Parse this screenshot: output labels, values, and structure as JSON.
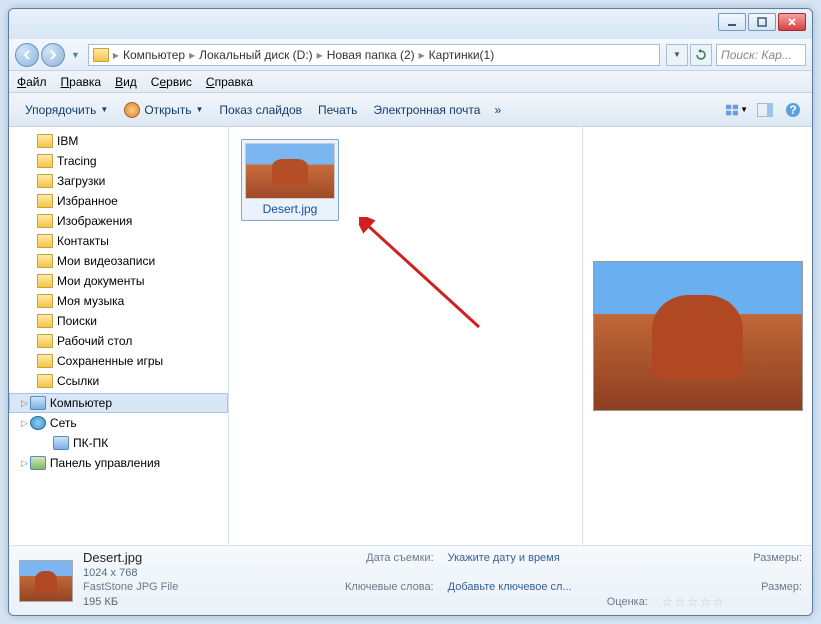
{
  "search_placeholder": "Поиск: Кар...",
  "breadcrumbs": [
    "Компьютер",
    "Локальный диск (D:)",
    "Новая папка (2)",
    "Картинки(1)"
  ],
  "menu": {
    "file": "Файл",
    "edit": "Правка",
    "view": "Вид",
    "tools": "Сервис",
    "help": "Справка"
  },
  "cmd": {
    "organize": "Упорядочить",
    "open": "Открыть",
    "slideshow": "Показ слайдов",
    "print": "Печать",
    "email": "Электронная почта"
  },
  "tree": {
    "items": [
      {
        "label": "IBM",
        "icon": "folder"
      },
      {
        "label": "Tracing",
        "icon": "folder"
      },
      {
        "label": "Загрузки",
        "icon": "folder"
      },
      {
        "label": "Избранное",
        "icon": "folder"
      },
      {
        "label": "Изображения",
        "icon": "folder"
      },
      {
        "label": "Контакты",
        "icon": "folder"
      },
      {
        "label": "Мои видеозаписи",
        "icon": "folder"
      },
      {
        "label": "Мои документы",
        "icon": "folder"
      },
      {
        "label": "Моя музыка",
        "icon": "folder"
      },
      {
        "label": "Поиски",
        "icon": "folder"
      },
      {
        "label": "Рабочий стол",
        "icon": "folder"
      },
      {
        "label": "Сохраненные игры",
        "icon": "folder"
      },
      {
        "label": "Ссылки",
        "icon": "folder"
      }
    ],
    "computer": "Компьютер",
    "network": "Сеть",
    "pc": "ПК-ПК",
    "cpanel": "Панель управления"
  },
  "file": {
    "name": "Desert.jpg"
  },
  "details": {
    "name": "Desert.jpg",
    "type": "FastStone JPG File",
    "date_label": "Дата съемки:",
    "date_value": "Укажите дату и время",
    "keywords_label": "Ключевые слова:",
    "keywords_value": "Добавьте ключевое сл...",
    "rating_label": "Оценка:",
    "dims_label": "Размеры:",
    "dims_value": "1024 x 768",
    "size_label": "Размер:",
    "size_value": "195 КБ"
  }
}
